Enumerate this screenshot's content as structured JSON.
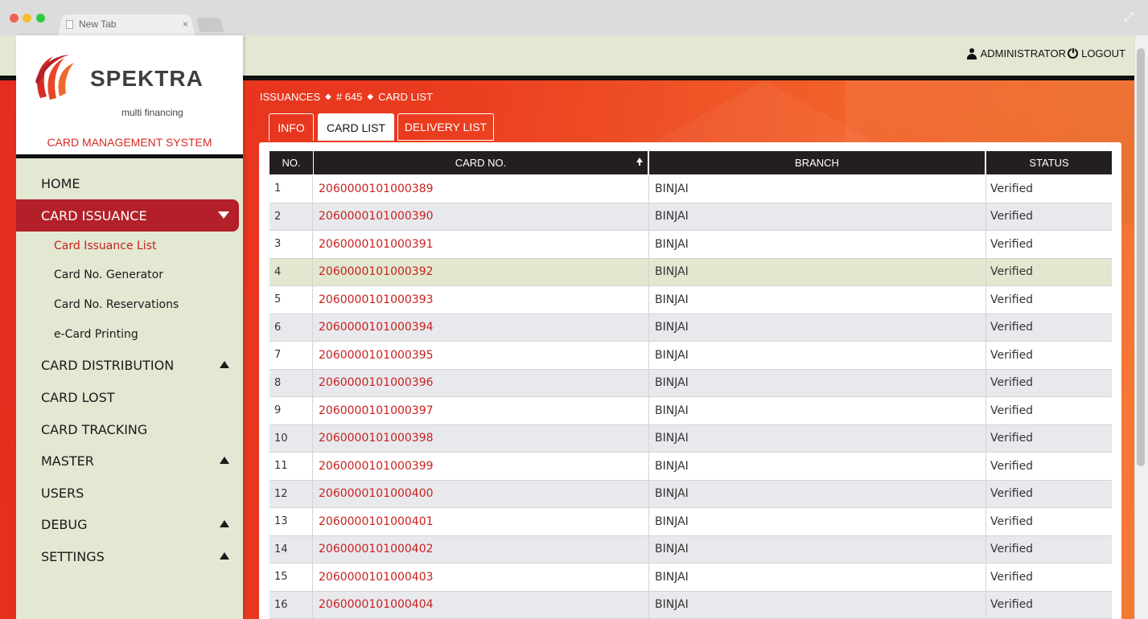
{
  "browser": {
    "tab_title": "New Tab",
    "tab_close": "×"
  },
  "header": {
    "user_label": "ADMINISTRATOR",
    "logout_label": "LOGOUT"
  },
  "brand": {
    "name": "SPEKTRA",
    "subtitle": "multi financing",
    "system": "CARD MANAGEMENT SYSTEM"
  },
  "sidebar": {
    "items": [
      {
        "label": "HOME"
      },
      {
        "label": "CARD ISSUANCE"
      },
      {
        "label": "CARD DISTRIBUTION"
      },
      {
        "label": "CARD LOST"
      },
      {
        "label": "CARD TRACKING"
      },
      {
        "label": "MASTER"
      },
      {
        "label": "USERS"
      },
      {
        "label": "DEBUG"
      },
      {
        "label": "SETTINGS"
      }
    ],
    "sub_items": [
      {
        "label": "Card Issuance List"
      },
      {
        "label": "Card No. Generator"
      },
      {
        "label": "Card No. Reservations"
      },
      {
        "label": "e-Card Printing"
      }
    ]
  },
  "breadcrumb": {
    "items": [
      "ISSUANCES",
      "# 645",
      "CARD LIST"
    ],
    "separator": "◆"
  },
  "tabs": [
    {
      "label": "INFO"
    },
    {
      "label": "CARD LIST"
    },
    {
      "label": "DELIVERY LIST"
    }
  ],
  "table": {
    "headers": {
      "no": "NO.",
      "card_no": "CARD NO.",
      "branch": "BRANCH",
      "status": "STATUS"
    },
    "rows": [
      {
        "no": "1",
        "card_no": "2060000101000389",
        "branch": "BINJAI",
        "status": "Verified"
      },
      {
        "no": "2",
        "card_no": "2060000101000390",
        "branch": "BINJAI",
        "status": "Verified"
      },
      {
        "no": "3",
        "card_no": "2060000101000391",
        "branch": "BINJAI",
        "status": "Verified"
      },
      {
        "no": "4",
        "card_no": "2060000101000392",
        "branch": "BINJAI",
        "status": "Verified"
      },
      {
        "no": "5",
        "card_no": "2060000101000393",
        "branch": "BINJAI",
        "status": "Verified"
      },
      {
        "no": "6",
        "card_no": "2060000101000394",
        "branch": "BINJAI",
        "status": "Verified"
      },
      {
        "no": "7",
        "card_no": "2060000101000395",
        "branch": "BINJAI",
        "status": "Verified"
      },
      {
        "no": "8",
        "card_no": "2060000101000396",
        "branch": "BINJAI",
        "status": "Verified"
      },
      {
        "no": "9",
        "card_no": "2060000101000397",
        "branch": "BINJAI",
        "status": "Verified"
      },
      {
        "no": "10",
        "card_no": "2060000101000398",
        "branch": "BINJAI",
        "status": "Verified"
      },
      {
        "no": "11",
        "card_no": "2060000101000399",
        "branch": "BINJAI",
        "status": "Verified"
      },
      {
        "no": "12",
        "card_no": "2060000101000400",
        "branch": "BINJAI",
        "status": "Verified"
      },
      {
        "no": "13",
        "card_no": "2060000101000401",
        "branch": "BINJAI",
        "status": "Verified"
      },
      {
        "no": "14",
        "card_no": "2060000101000402",
        "branch": "BINJAI",
        "status": "Verified"
      },
      {
        "no": "15",
        "card_no": "2060000101000403",
        "branch": "BINJAI",
        "status": "Verified"
      },
      {
        "no": "16",
        "card_no": "2060000101000404",
        "branch": "BINJAI",
        "status": "Verified"
      }
    ]
  },
  "colors": {
    "accent_red": "#c8211f",
    "active_nav": "#b3202a",
    "sidebar_bg": "#e2e8d2",
    "header_dark": "#231f20"
  }
}
